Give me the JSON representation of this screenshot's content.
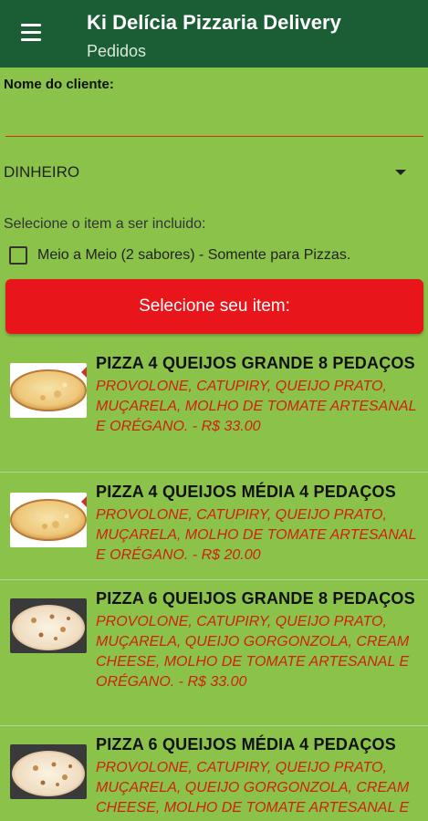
{
  "appbar": {
    "title": "Ki Delícia Pizzaria Delivery",
    "subtitle": "Pedidos",
    "menu_icon": "hamburger-menu-icon",
    "color": "#1b5e36"
  },
  "form": {
    "client_label": "Nome do cliente:",
    "client_value": "",
    "payment_selected": "DINHEIRO",
    "select_hint": "Selecione o item a ser incluido:",
    "half_half_label": "Meio a Meio (2 sabores) - Somente para Pizzas.",
    "half_half_checked": false,
    "select_button_label": "Selecione seu item:"
  },
  "colors": {
    "background": "#8bc34a",
    "accent_red": "#e8151a",
    "description_red": "#d0200f"
  },
  "items": [
    {
      "name": "PIZZA 4 QUEIJOS GRANDE 8 PEDAÇOS",
      "description": "PROVOLONE, CATUPIRY, QUEIJO PRATO, MUÇARELA, MOLHO DE TOMATE ARTESANAL E ORÉGANO. - R$ 33.00",
      "image": "pizza-4-queijos-image"
    },
    {
      "name": "PIZZA 4 QUEIJOS MÉDIA 4 PEDAÇOS",
      "description": "PROVOLONE, CATUPIRY, QUEIJO PRATO, MUÇARELA, MOLHO DE TOMATE ARTESANAL E ORÉGANO. - R$ 20.00",
      "image": "pizza-4-queijos-image"
    },
    {
      "name": "PIZZA 6 QUEIJOS GRANDE 8 PEDAÇOS",
      "description": "PROVOLONE, CATUPIRY, QUEIJO PRATO, MUÇARELA, QUEIJO GORGONZOLA, CREAM CHEESE, MOLHO DE TOMATE ARTESANAL E ORÉGANO. - R$ 33.00",
      "image": "pizza-6-queijos-image"
    },
    {
      "name": "PIZZA 6 QUEIJOS MÉDIA 4 PEDAÇOS",
      "description": "PROVOLONE, CATUPIRY, QUEIJO PRATO, MUÇARELA, QUEIJO GORGONZOLA, CREAM CHEESE, MOLHO DE TOMATE ARTESANAL E",
      "image": "pizza-6-queijos-image"
    }
  ]
}
